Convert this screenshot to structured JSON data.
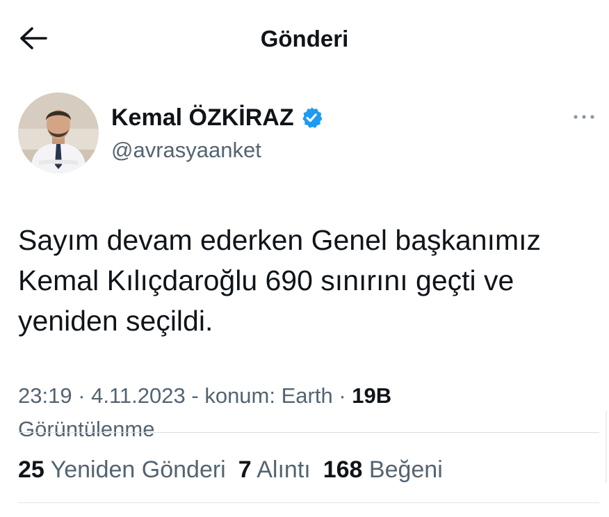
{
  "header": {
    "title": "Gönderi",
    "back_icon": "arrow-left-icon"
  },
  "author": {
    "name": "Kemal ÖZKİRAZ",
    "handle": "@avrasyaanket",
    "verified_icon": "verified-badge-icon",
    "verified_color": "#1d9bf0",
    "more_icon": "more-horizontal-icon"
  },
  "tweet": {
    "text": "Sayım devam ederken Genel başkanımız Kemal Kılıçdaroğlu 690 sınırını geçti ve yeniden seçildi."
  },
  "meta": {
    "time": "23:19",
    "date": "4.11.2023",
    "location_text": "konum: Earth",
    "views_count": "19B",
    "views_label": "Görüntülenme"
  },
  "stats": {
    "reposts_count": "25",
    "reposts_label": "Yeniden Gönderi",
    "quotes_count": "7",
    "quotes_label": "Alıntı",
    "likes_count": "168",
    "likes_label": "Beğeni"
  },
  "colors": {
    "text": "#0f1419",
    "secondary": "#536471",
    "divider": "#d9dde0"
  }
}
